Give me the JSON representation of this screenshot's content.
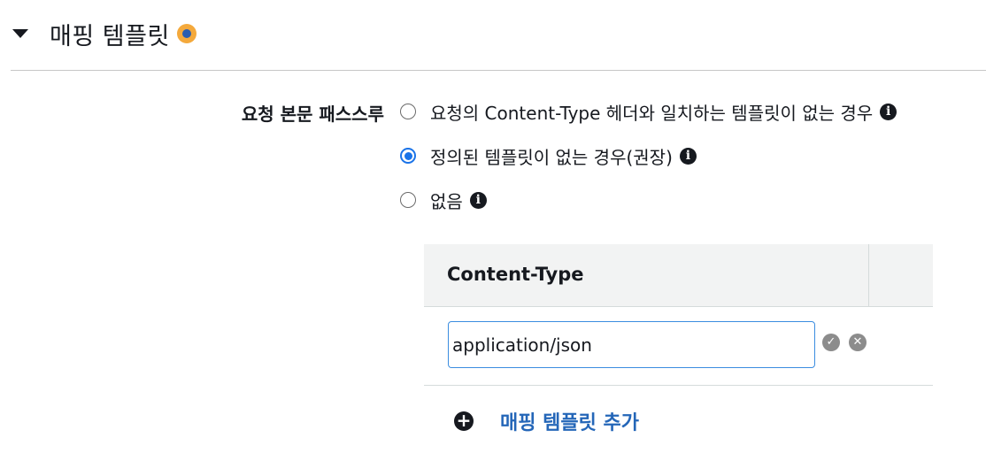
{
  "section": {
    "title": "매핑 템플릿"
  },
  "passthrough": {
    "label": "요청 본문 패스스루",
    "options": [
      {
        "label": "요청의 Content-Type 헤더와 일치하는 템플릿이 없는 경우",
        "checked": false
      },
      {
        "label": "정의된 템플릿이 없는 경우(권장)",
        "checked": true
      },
      {
        "label": "없음",
        "checked": false
      }
    ]
  },
  "table": {
    "column_header": "Content-Type",
    "row_input_value": "application/json"
  },
  "add_template_label": "매핑 템플릿 추가",
  "colors": {
    "accent": "#1a73e8",
    "link": "#2466b8",
    "status_outer": "#f4a93c",
    "status_inner": "#2a5db0"
  }
}
